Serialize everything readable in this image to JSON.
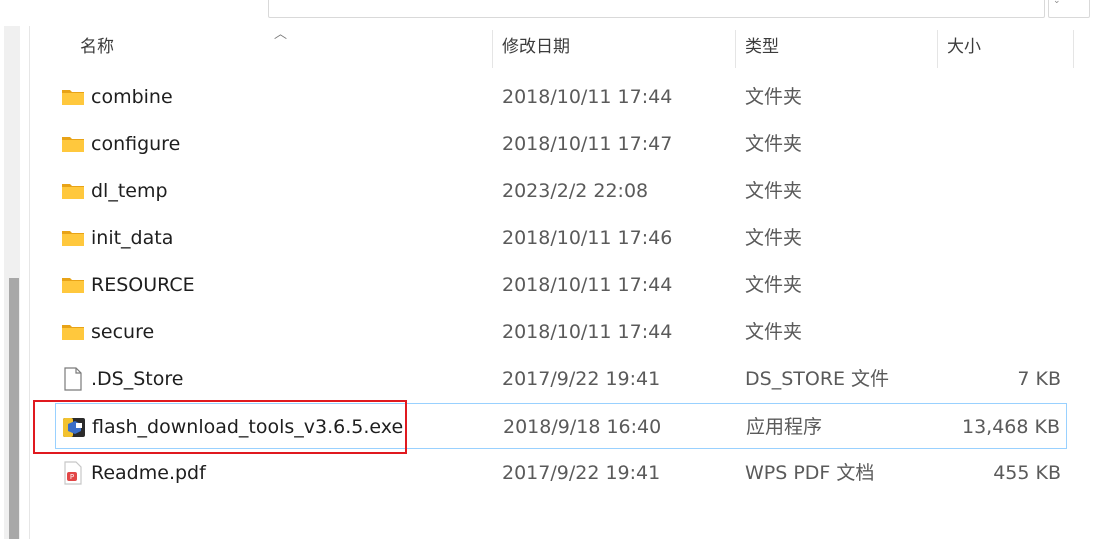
{
  "columns": {
    "name": "名称",
    "date": "修改日期",
    "type": "类型",
    "size": "大小"
  },
  "files": [
    {
      "name": "combine",
      "date": "2018/10/11 17:44",
      "type": "文件夹",
      "size": "",
      "icon": "folder-icon"
    },
    {
      "name": "configure",
      "date": "2018/10/11 17:47",
      "type": "文件夹",
      "size": "",
      "icon": "folder-icon"
    },
    {
      "name": "dl_temp",
      "date": "2023/2/2 22:08",
      "type": "文件夹",
      "size": "",
      "icon": "folder-icon"
    },
    {
      "name": "init_data",
      "date": "2018/10/11 17:46",
      "type": "文件夹",
      "size": "",
      "icon": "folder-icon"
    },
    {
      "name": "RESOURCE",
      "date": "2018/10/11 17:44",
      "type": "文件夹",
      "size": "",
      "icon": "folder-icon"
    },
    {
      "name": "secure",
      "date": "2018/10/11 17:44",
      "type": "文件夹",
      "size": "",
      "icon": "folder-icon"
    },
    {
      "name": ".DS_Store",
      "date": "2017/9/22 19:41",
      "type": "DS_STORE 文件",
      "size": "7 KB",
      "icon": "document-icon"
    },
    {
      "name": "flash_download_tools_v3.6.5.exe",
      "date": "2018/9/18 16:40",
      "type": "应用程序",
      "size": "13,468 KB",
      "icon": "exe-icon"
    },
    {
      "name": "Readme.pdf",
      "date": "2017/9/22 19:41",
      "type": "WPS PDF 文档",
      "size": "455 KB",
      "icon": "pdf-icon"
    }
  ],
  "colors": {
    "folder": "#ffc83d",
    "selection_border": "#99d1ff",
    "highlight": "#e0191f"
  }
}
